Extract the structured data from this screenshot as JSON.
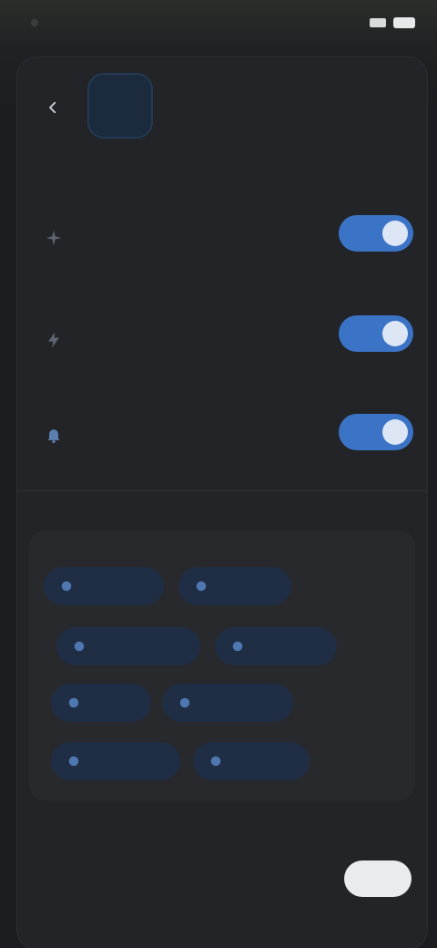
{
  "status": {
    "time": ""
  },
  "header": {
    "title": ""
  },
  "sections": {
    "main_label": "",
    "chips_label": ""
  },
  "settings": [
    {
      "title": "",
      "description": "",
      "enabled": true,
      "icon": "sparkle-icon"
    },
    {
      "title": "",
      "description": "",
      "enabled": true,
      "icon": "bolt-icon"
    },
    {
      "title": "",
      "description": "",
      "enabled": true,
      "icon": "bell-icon"
    }
  ],
  "chips": [
    {
      "label": ""
    },
    {
      "label": ""
    },
    {
      "label": ""
    },
    {
      "label": ""
    },
    {
      "label": ""
    },
    {
      "label": ""
    },
    {
      "label": ""
    },
    {
      "label": ""
    }
  ],
  "footer": {
    "note": "",
    "link_primary": "",
    "link_secondary": "",
    "primary_button": ""
  },
  "colors": {
    "accent": "#3b74c6",
    "chip_text": "#7fa9e2",
    "sheet_bg": "#232428",
    "danger": "#c0392b"
  }
}
